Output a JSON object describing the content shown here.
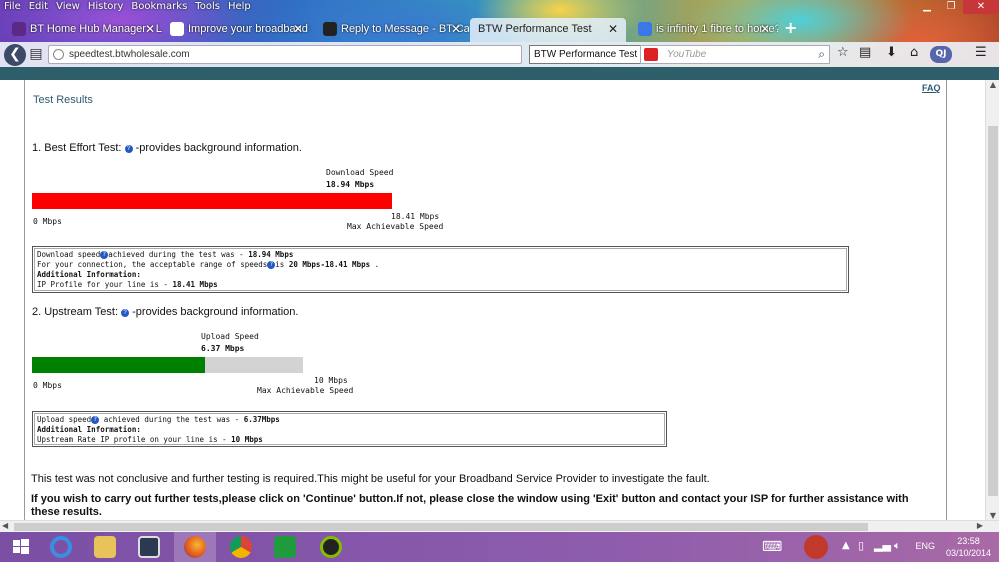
{
  "colors": {
    "download_bar": "#ff0000",
    "upload_bar": "#008000",
    "track": "#d3d3d3",
    "heading": "#2f5a73"
  },
  "menu": [
    "File",
    "Edit",
    "View",
    "History",
    "Bookmarks",
    "Tools",
    "Help"
  ],
  "tabs": [
    {
      "title": "BT Home Hub Manager - L...",
      "icon": "bt-icon",
      "active": false
    },
    {
      "title": "Improve your broadband s...",
      "icon": "page-icon",
      "active": false
    },
    {
      "title": "Reply to Message - BT Care...",
      "icon": "bt-icon",
      "active": false
    },
    {
      "title": "BTW Performance Test",
      "icon": "page-icon",
      "active": true
    },
    {
      "title": "is infinity 1 fibre to home?...",
      "icon": "google-icon",
      "active": false
    }
  ],
  "navbar": {
    "url": "speedtest.btwholesale.com",
    "title_tooltip": "BTW Performance Test",
    "search_placeholder": "YouTube",
    "profile_badge": "QJ"
  },
  "page": {
    "section_title": "Test Results",
    "faq": "FAQ",
    "download": {
      "heading_prefix": "1. Best Effort Test:",
      "heading_suffix": "-provides background information.",
      "caption": "Download Speed",
      "value_label": "18.94 Mbps",
      "measured_mbps": 18.94,
      "max_mbps": 18.41,
      "min_label": "0 Mbps",
      "max_label": "18.41 Mbps",
      "max_caption": "Max Achievable Speed",
      "info": {
        "line1_prefix": "Download speed",
        "line1_mid": "achieved during the test was - ",
        "line1_value": "18.94 Mbps",
        "line2_prefix": "For your connection, the acceptable range of speeds",
        "line2_mid": "is ",
        "line2_value": "20 Mbps-18.41 Mbps",
        "line2_end": " .",
        "line3": "Additional Information:",
        "line4_prefix": "IP Profile for your line is - ",
        "line4_value": "18.41 Mbps"
      }
    },
    "upload": {
      "heading_prefix": "2. Upstream Test:",
      "heading_suffix": "-provides background information.",
      "caption": "Upload Speed",
      "value_label": "6.37 Mbps",
      "measured_mbps": 6.37,
      "max_mbps": 10,
      "min_label": "0 Mbps",
      "max_label": "10 Mbps",
      "max_caption": "Max Achievable Speed",
      "info": {
        "line1_prefix": "Upload speed",
        "line1_mid": " achieved during the test was - ",
        "line1_value": "6.37Mbps",
        "line2": "Additional Information:",
        "line3_prefix": "Upstream Rate IP profile on your line is - ",
        "line3_value": "10 Mbps"
      }
    },
    "conclusion": "This test was not conclusive and further testing is required.This might be useful for your Broadband Service Provider to investigate the fault.",
    "instruction": "If you wish to carry out further tests,please click on 'Continue' button.If not, please close the window using 'Exit' button and contact your ISP for further assistance with these results."
  },
  "taskbar": {
    "apps": [
      {
        "name": "start-icon"
      },
      {
        "name": "internet-explorer-icon"
      },
      {
        "name": "file-explorer-icon"
      },
      {
        "name": "lenovo-icon"
      },
      {
        "name": "firefox-icon",
        "active": true
      },
      {
        "name": "chrome-icon"
      },
      {
        "name": "store-icon"
      },
      {
        "name": "spotify-icon"
      }
    ],
    "language": "ENG",
    "time": "23:58",
    "date": "03/10/2014"
  }
}
